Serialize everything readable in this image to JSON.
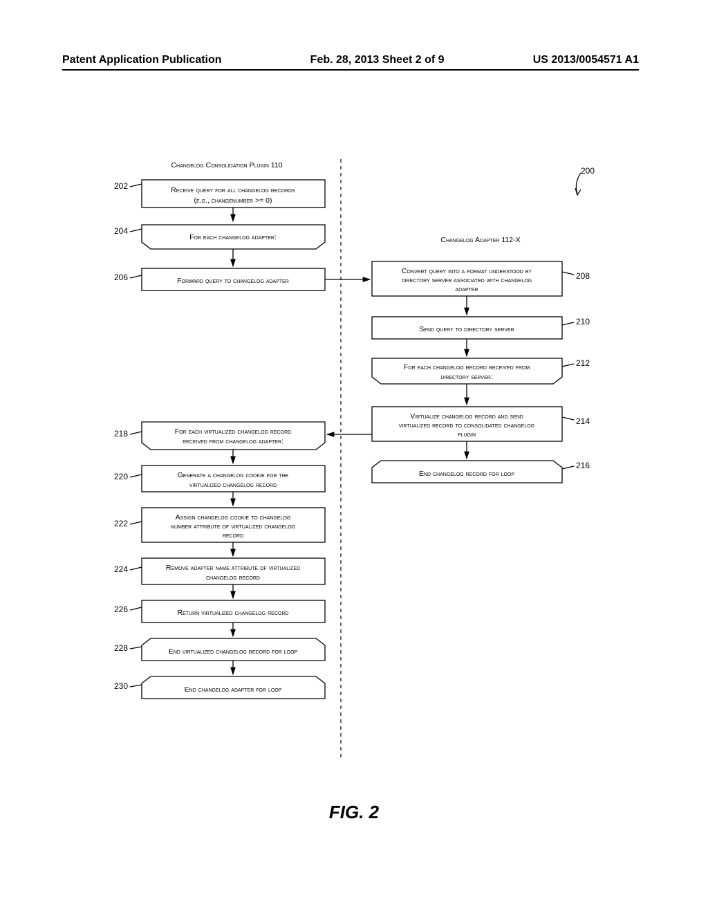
{
  "header": {
    "left": "Patent Application Publication",
    "center": "Feb. 28, 2013  Sheet 2 of 9",
    "right": "US 2013/0054571 A1"
  },
  "diagram": {
    "left_title": "Changelog Consolidation Plugin 110",
    "right_title": "Changelog Adapter 112-X",
    "pointer_label": "200",
    "boxes": {
      "202": "Receive query for all changelog records (e.g., changenumber >= 0)",
      "204": "For each changelog adapter:",
      "206": "Forward query to changelog adapter",
      "208": "Convert query into a format understood by directory server associated with changelog adapter",
      "210": "Send query to directory server",
      "212": "For each changelog record received from directory server:",
      "214": "Virtualize changelog record and send virtualized record to consolidated changelog plugin",
      "216": "End changelog record for loop",
      "218": "For each virtualized changelog record received from changelog adapter:",
      "220": "Generate a changelog cookie for the virtualized changelog record",
      "222": "Assign changelog cookie to changelog number attribute of virtualized changelog record",
      "224": "Remove adapter name attribute of virtualized changelog record",
      "226": "Return virtualized changelog record",
      "228": "End virtualized changelog record for loop",
      "230": "End changelog adapter for loop"
    }
  },
  "figure_label": "FIG. 2"
}
